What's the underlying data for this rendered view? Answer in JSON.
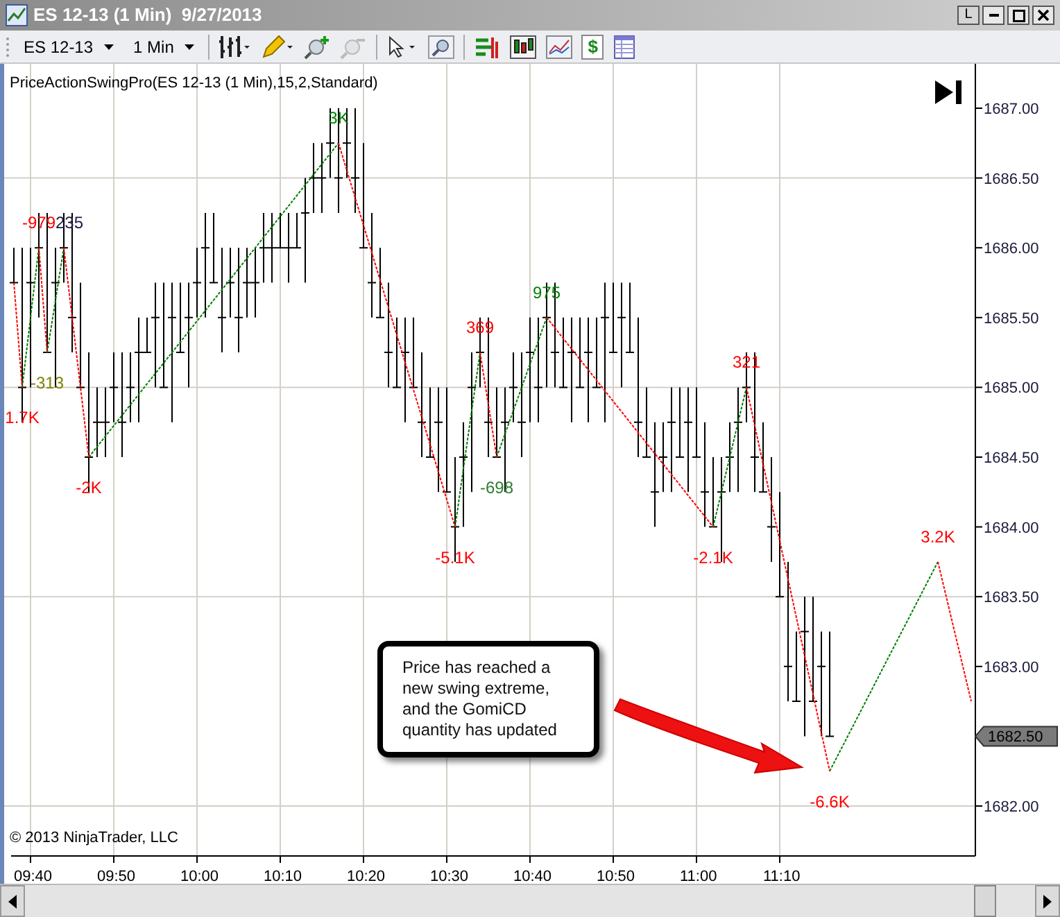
{
  "window": {
    "title": "ES 12-13 (1 Min)  9/27/2013",
    "buttons": [
      "L"
    ]
  },
  "toolbar": {
    "instrument": "ES 12-13",
    "interval": "1 Min",
    "currency_glyph": "$"
  },
  "chart": {
    "indicator_label": "PriceActionSwingPro(ES 12-13 (1 Min),15,2,Standard)",
    "swing_labels": [
      {
        "text": "1.7K",
        "color": "#ff0000"
      },
      {
        "text": "-979",
        "color": "#ff0000"
      },
      {
        "text": "235",
        "color": "#1a1a40"
      },
      {
        "text": "-313",
        "color": "#808000"
      },
      {
        "text": "-2K",
        "color": "#ff0000"
      },
      {
        "text": "3K",
        "color": "#008000"
      },
      {
        "text": "-5.1K",
        "color": "#ff0000"
      },
      {
        "text": "369",
        "color": "#ff0000"
      },
      {
        "text": "-698",
        "color": "#2e7d32"
      },
      {
        "text": "975",
        "color": "#008000"
      },
      {
        "text": "-2.1K",
        "color": "#ff0000"
      },
      {
        "text": "321",
        "color": "#ff0000"
      },
      {
        "text": "-6.6K",
        "color": "#ff0000"
      },
      {
        "text": "3.2K",
        "color": "#ff0000"
      }
    ],
    "callout": "Price has reached a new swing extreme, and the GomiCD quantity has updated",
    "copyright": "© 2013 NinjaTrader, LLC",
    "price_axis": [
      "1687.00",
      "1686.50",
      "1686.00",
      "1685.50",
      "1685.00",
      "1684.50",
      "1684.00",
      "1683.50",
      "1683.00",
      "1682.00"
    ],
    "current_price": "1682.50",
    "time_axis": [
      "09:40",
      "09:50",
      "10:00",
      "10:10",
      "10:20",
      "10:30",
      "10:40",
      "10:50",
      "11:00",
      "11:10"
    ]
  }
}
